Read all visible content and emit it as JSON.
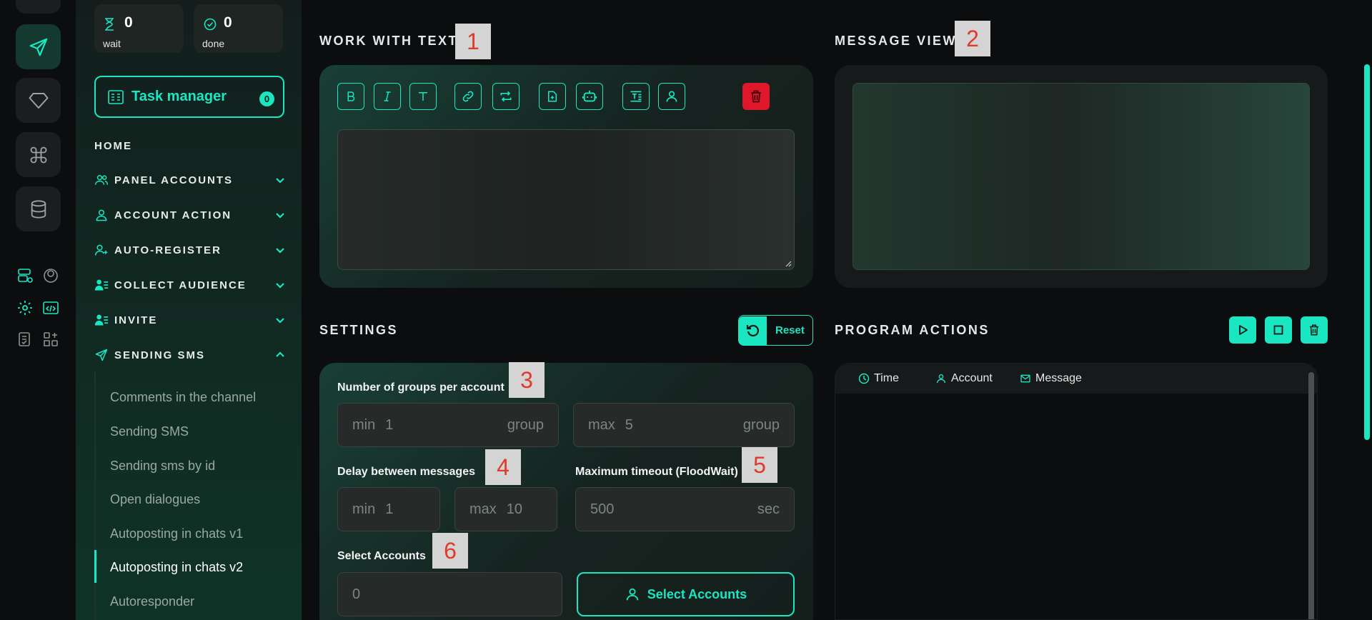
{
  "stats": {
    "wait": {
      "value": "0",
      "label": "wait"
    },
    "done": {
      "value": "0",
      "label": "done"
    }
  },
  "task_manager": {
    "label": "Task manager",
    "count": "0"
  },
  "nav": {
    "home": "HOME",
    "items": [
      {
        "label": "PANEL ACCOUNTS",
        "icon": "users-icon"
      },
      {
        "label": "ACCOUNT ACTION",
        "icon": "user-icon"
      },
      {
        "label": "AUTO-REGISTER",
        "icon": "user-plus-icon"
      },
      {
        "label": "COLLECT AUDIENCE",
        "icon": "user-list-icon"
      },
      {
        "label": "INVITE",
        "icon": "user-list-icon"
      },
      {
        "label": "SENDING SMS",
        "icon": "send-icon",
        "expanded": true
      }
    ],
    "sub_items": [
      "Comments in the channel",
      "Sending SMS",
      "Sending sms by id",
      "Open dialogues",
      "Autoposting in chats v1",
      "Autoposting in chats v2",
      "Autoresponder"
    ],
    "active_sub": "Autoposting in chats v2"
  },
  "sections": {
    "work_with_text": "WORK WITH TEXT",
    "message_view": "MESSAGE VIEW",
    "settings": "SETTINGS",
    "program_actions": "PROGRAM ACTIONS"
  },
  "markers": [
    "1",
    "2",
    "3",
    "4",
    "5",
    "6"
  ],
  "toolbar": [
    "bold",
    "italic",
    "text",
    "link",
    "repeat",
    "file-plus",
    "bot",
    "format",
    "user",
    "trash"
  ],
  "reset_label": "Reset",
  "settings": {
    "groups_label": "Number of groups per account",
    "groups_min": {
      "key": "min",
      "value": "1",
      "unit": "group"
    },
    "groups_max": {
      "key": "max",
      "value": "5",
      "unit": "group"
    },
    "delay_label": "Delay between messages",
    "delay_min": {
      "key": "min",
      "value": "1"
    },
    "delay_max": {
      "key": "max",
      "value": "10"
    },
    "timeout_label": "Maximum timeout (FloodWait)",
    "timeout": {
      "value": "500",
      "unit": "sec"
    },
    "accounts_label": "Select Accounts",
    "accounts_value": "0",
    "select_accounts_button": "Select Accounts"
  },
  "log": {
    "columns": [
      "Time",
      "Account",
      "Message"
    ]
  },
  "colors": {
    "accent": "#1ae6c1",
    "danger": "#e0162b",
    "marker": "#e03a2a"
  }
}
